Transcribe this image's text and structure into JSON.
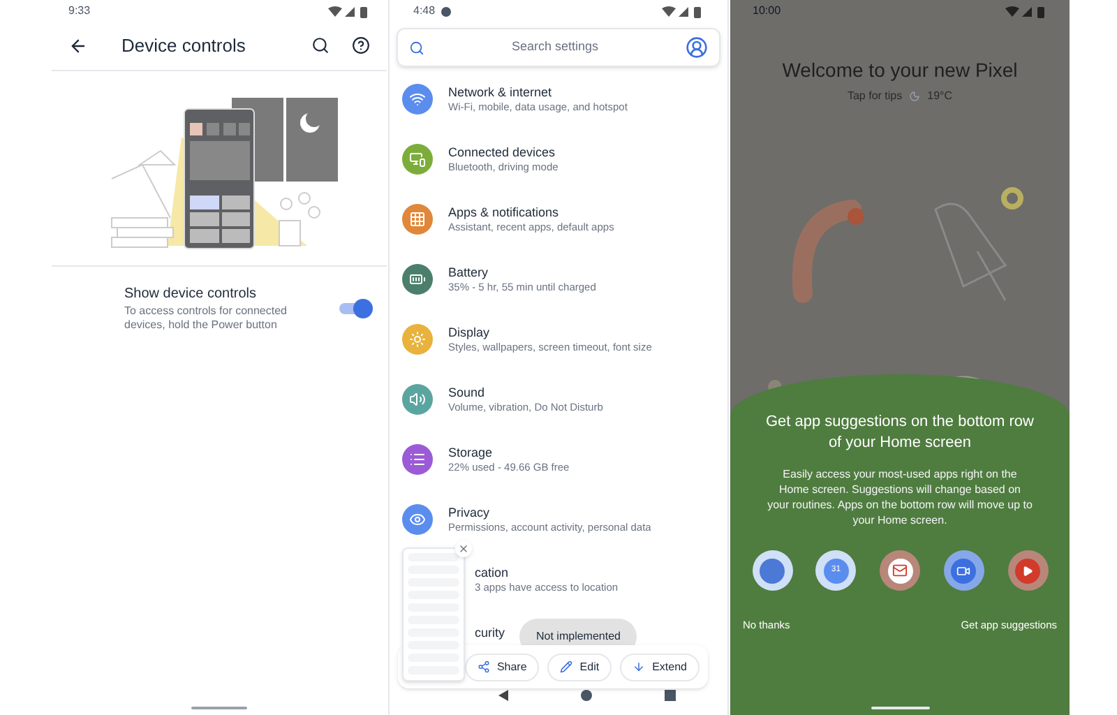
{
  "device_controls": {
    "status_time": "9:33",
    "title": "Device controls",
    "setting": {
      "title": "Show device controls",
      "description": "To access controls for connected devices, hold the Power button",
      "on": true
    }
  },
  "settings": {
    "status_time": "4:48",
    "search": {
      "placeholder": "Search settings"
    },
    "items": [
      {
        "kind": "wifi",
        "title": "Network & internet",
        "subtitle": "Wi-Fi, mobile, data usage, and hotspot",
        "color": "#5b8def"
      },
      {
        "kind": "devices",
        "title": "Connected devices",
        "subtitle": "Bluetooth, driving mode",
        "color": "#7cad3a"
      },
      {
        "kind": "apps",
        "title": "Apps & notifications",
        "subtitle": "Assistant, recent apps, default apps",
        "color": "#e0873a"
      },
      {
        "kind": "battery",
        "title": "Battery",
        "subtitle": "35% - 5 hr, 55 min until charged",
        "color": "#4b7f6c"
      },
      {
        "kind": "display",
        "title": "Display",
        "subtitle": "Styles, wallpapers, screen timeout, font size",
        "color": "#e8b23c"
      },
      {
        "kind": "sound",
        "title": "Sound",
        "subtitle": "Volume, vibration, Do Not Disturb",
        "color": "#5aa5a0"
      },
      {
        "kind": "storage",
        "title": "Storage",
        "subtitle": "22% used - 49.66 GB free",
        "color": "#9b5bd6"
      },
      {
        "kind": "privacy",
        "title": "Privacy",
        "subtitle": "Permissions, account activity, personal data",
        "color": "#5b8def"
      },
      {
        "kind": "covered",
        "title": "cation",
        "subtitle": "3 apps have access to location"
      },
      {
        "kind": "covered",
        "title": "curity"
      }
    ],
    "toast": "Not implemented",
    "actions": [
      {
        "kind": "share",
        "label": "Share"
      },
      {
        "kind": "edit",
        "label": "Edit"
      },
      {
        "kind": "extend",
        "label": "Extend"
      }
    ]
  },
  "home": {
    "status_time": "10:00",
    "title": "Welcome to your new Pixel",
    "tips": "Tap for tips",
    "temperature": "19°C",
    "sheet": {
      "title": "Get app suggestions on the bottom row of your Home screen",
      "body": "Easily access your most-used apps right on the Home screen. Suggestions will change based on your routines. Apps on the bottom row will move up to your Home screen.",
      "apps": [
        {
          "kind": "photos"
        },
        {
          "kind": "calendar",
          "label": "31"
        },
        {
          "kind": "gmail"
        },
        {
          "kind": "duo"
        },
        {
          "kind": "youtube"
        }
      ],
      "dismiss": "No thanks",
      "accept": "Get app suggestions"
    }
  }
}
